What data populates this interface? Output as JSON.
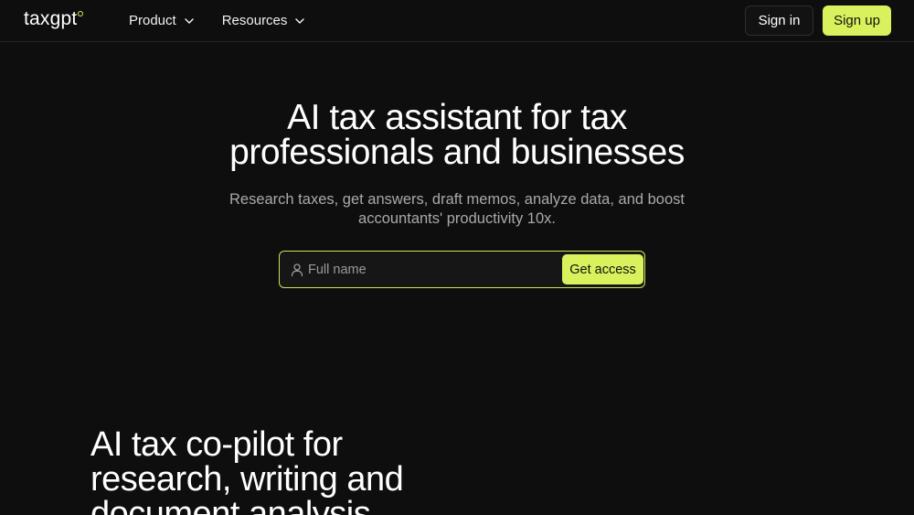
{
  "brand": {
    "name": "taxgpt",
    "accent": "#d9f15c"
  },
  "nav": {
    "items": [
      {
        "label": "Product",
        "icon": "chevron-down-icon"
      },
      {
        "label": "Resources",
        "icon": "chevron-down-icon"
      }
    ],
    "sign_in": "Sign in",
    "sign_up": "Sign up"
  },
  "hero": {
    "title_line1": "AI tax assistant for tax",
    "title_line2": "professionals and businesses",
    "subtitle_line1": "Research taxes, get answers, draft memos, analyze data, and boost",
    "subtitle_line2": "accountants' productivity 10x.",
    "input_placeholder": "Full name",
    "input_icon": "user-icon",
    "cta": "Get access"
  },
  "section": {
    "title_line1": "AI tax co-pilot for",
    "title_line2": "research, writing and",
    "title_line3": "document analysis"
  }
}
